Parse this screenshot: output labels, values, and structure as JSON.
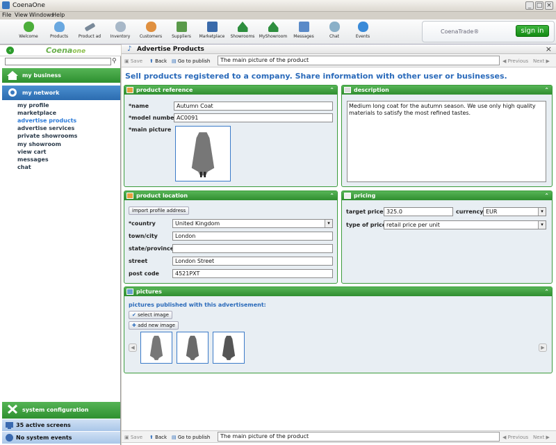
{
  "window": {
    "title": "CoenaOne"
  },
  "menu": [
    "File",
    "View",
    "Windows",
    "Help"
  ],
  "toolbar": {
    "items": [
      "Welcome",
      "Products",
      "Product ad",
      "Inventory",
      "Customers",
      "Suppliers",
      "Marketplace",
      "Showrooms",
      "MyShowroom",
      "Messages",
      "Chat",
      "Events"
    ],
    "trade_name": "CoenaTrade®",
    "signin_label": "sign in"
  },
  "sidebar": {
    "logo_main": "Coena",
    "logo_sub": "one",
    "search_placeholder": "",
    "my_business": "my business",
    "my_network": "my network",
    "network_items": [
      "my profile",
      "marketplace",
      "advertise products",
      "advertise services",
      "private showrooms",
      "my showroom",
      "view cart",
      "messages",
      "chat"
    ],
    "active_item": "advertise products",
    "system_configuration": "system configuration",
    "active_screens": "35 active screens",
    "system_events": "No system events"
  },
  "page": {
    "title": "Advertise Products",
    "heading": "Sell products registered to a company. Share information with other user or businesses.",
    "nav": {
      "save": "Save",
      "back": "Back",
      "go_to_publish": "Go to publish",
      "main_picture_field": "The main picture of the product",
      "previous": "Previous",
      "next": "Next"
    }
  },
  "product_reference": {
    "title": "product reference",
    "name_label": "*name",
    "name_value": "Autumn Coat",
    "model_label": "*model number",
    "model_value": "AC0091",
    "picture_label": "*main picture"
  },
  "description": {
    "title": "description",
    "text": "Medium long coat for the autumn season. We use only high quality materials to satisfy the most refined tastes."
  },
  "product_location": {
    "title": "product location",
    "import_label": "import profile address",
    "country_label": "*country",
    "country_value": "United Kingdom",
    "town_label": "town/city",
    "town_value": "London",
    "state_label": "state/province",
    "state_value": "",
    "street_label": "street",
    "street_value": "London Street",
    "postcode_label": "post code",
    "postcode_value": "4521PXT"
  },
  "pricing": {
    "title": "pricing",
    "target_label": "target price",
    "target_value": "325.0",
    "currency_label": "currency",
    "currency_value": "EUR",
    "type_label": "type of price",
    "type_value": "retail price per unit"
  },
  "pictures": {
    "title": "pictures",
    "published_label": "pictures published with this advertisement:",
    "select_label": "select image",
    "add_label": "add new image"
  },
  "colors": {
    "accent_green": "#2f8e30",
    "accent_blue": "#2a6aba"
  }
}
